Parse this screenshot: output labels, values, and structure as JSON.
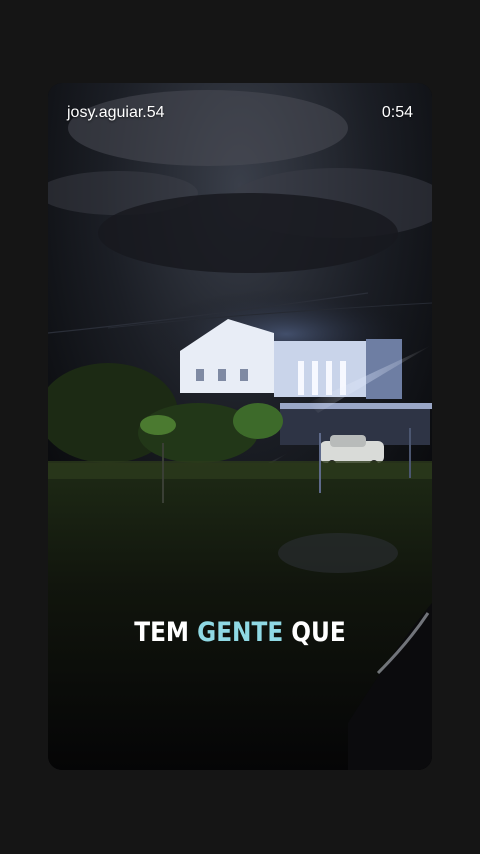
{
  "story": {
    "username": "josy.aguiar.54",
    "timer": "0:54",
    "caption": {
      "part1": "TEM",
      "highlight": "GENTE",
      "part2": "QUE"
    },
    "colors": {
      "highlight": "#8fd9e4",
      "text": "#ffffff",
      "background": "#151515"
    }
  }
}
